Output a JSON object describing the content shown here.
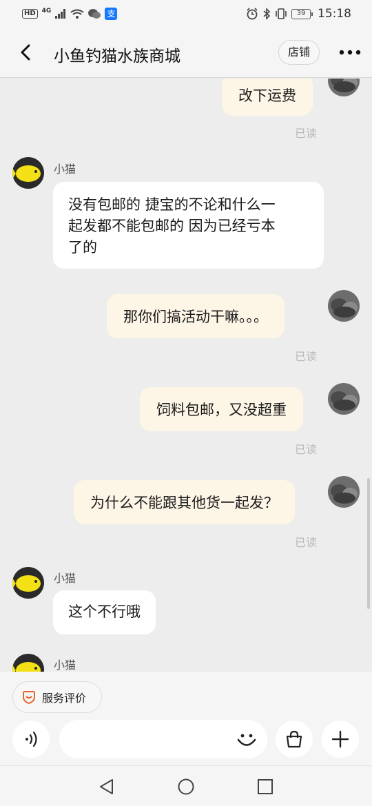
{
  "status_bar": {
    "hd": "HD",
    "network": "4G",
    "battery": "39",
    "time": "15:18",
    "alipay_glyph": "支"
  },
  "nav": {
    "title": "小鱼钓猫水族商城",
    "shop_label": "店铺"
  },
  "messages": [
    {
      "from": "me",
      "text": "改下运费",
      "status": "已读"
    },
    {
      "from": "shop",
      "sender": "小猫",
      "lines": [
        "没有包邮的 捷宝的不论和什么一",
        "起发都不能包邮的  因为已经亏本",
        "了的"
      ]
    },
    {
      "from": "me",
      "text": "那你们搞活动干嘛。。。",
      "status": "已读"
    },
    {
      "from": "me",
      "text": "饲料包邮，又没超重",
      "status": "已读"
    },
    {
      "from": "me",
      "text": "为什么不能跟其他货一起发？",
      "status": "已读"
    },
    {
      "from": "shop",
      "sender": "小猫",
      "lines": [
        "这个不行哦"
      ]
    },
    {
      "from": "shop",
      "sender": "小猫",
      "lines": []
    }
  ],
  "bottom": {
    "service_label": "服务评价",
    "input_placeholder": ""
  },
  "icons": {
    "back": "chevron-left-icon",
    "more": "more-dots-icon",
    "voice": "voice-icon",
    "emoji": "emoji-icon",
    "bag": "shopping-bag-icon",
    "plus": "plus-icon",
    "service": "service-rating-icon"
  },
  "colors": {
    "outgoing_bubble": "#fdf6e7",
    "incoming_bubble": "#ffffff",
    "background": "#ededed",
    "accent": "#e8622c"
  }
}
